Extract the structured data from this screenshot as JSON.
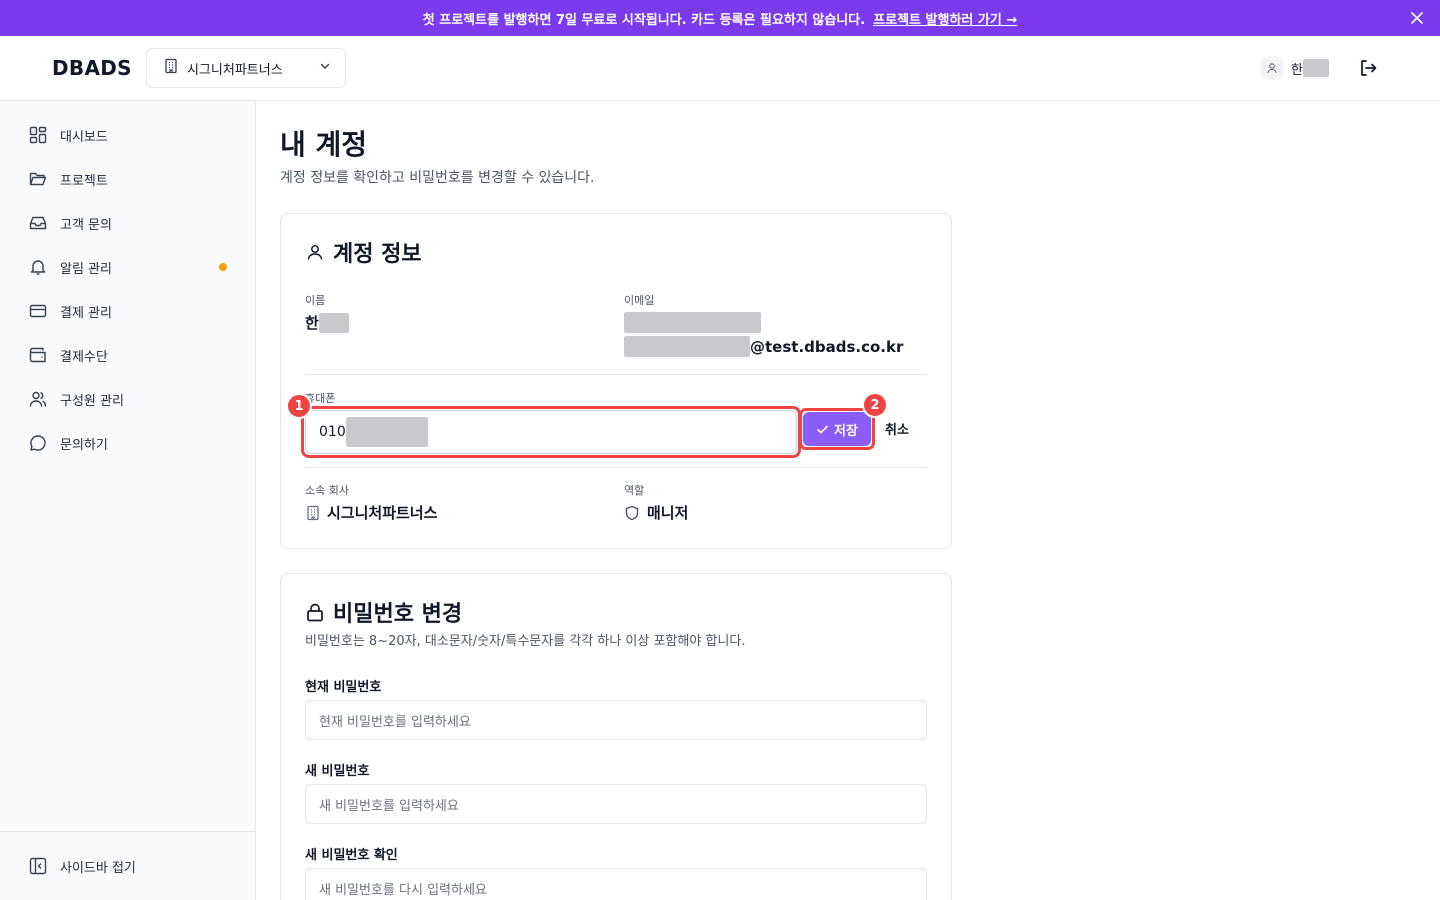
{
  "banner": {
    "text": "첫 프로젝트를 발행하면 7일 무료로 시작됩니다. 카드 등록은 필요하지 않습니다.",
    "link": "프로젝트 발행하러 가기 →",
    "close_icon": "close-icon",
    "bg_color": "#7c3aed"
  },
  "header": {
    "logo": "DBADS",
    "company_select": "시그니처파트너스",
    "user_name": "한"
  },
  "sidebar": {
    "items": [
      {
        "label": "대시보드",
        "icon": "dashboard-icon"
      },
      {
        "label": "프로젝트",
        "icon": "folder-icon"
      },
      {
        "label": "고객 문의",
        "icon": "inbox-icon"
      },
      {
        "label": "알림 관리",
        "icon": "bell-icon",
        "has_dot": true
      },
      {
        "label": "결제 관리",
        "icon": "credit-card-icon"
      },
      {
        "label": "결제수단",
        "icon": "wallet-icon"
      },
      {
        "label": "구성원 관리",
        "icon": "users-icon"
      },
      {
        "label": "문의하기",
        "icon": "message-icon"
      }
    ],
    "collapse": "사이드바 접기",
    "dot_color": "#f59e0b"
  },
  "page": {
    "title": "내 계정",
    "subtitle": "계정 정보를 확인하고 비밀번호를 변경할 수 있습니다."
  },
  "account": {
    "title": "계정 정보",
    "name_label": "이름",
    "name_value": "한",
    "email_label": "이메일",
    "email_suffix": "@test.dbads.co.kr",
    "phone_label": "휴대폰",
    "phone_value": "010",
    "save": "저장",
    "cancel": "취소",
    "company_label": "소속 회사",
    "company_value": "시그니처파트너스",
    "role_label": "역할",
    "role_value": "매니저",
    "badges": [
      "1",
      "2"
    ],
    "highlight_color": "#ef4444"
  },
  "password": {
    "title": "비밀번호 변경",
    "hint": "비밀번호는 8~20자, 대소문자/숫자/특수문자를 각각 하나 이상 포함해야 합니다.",
    "current_label": "현재 비밀번호",
    "current_placeholder": "현재 비밀번호를 입력하세요",
    "new_label": "새 비밀번호",
    "new_placeholder": "새 비밀번호를 입력하세요",
    "confirm_label": "새 비밀번호 확인",
    "confirm_placeholder": "새 비밀번호를 다시 입력하세요"
  }
}
